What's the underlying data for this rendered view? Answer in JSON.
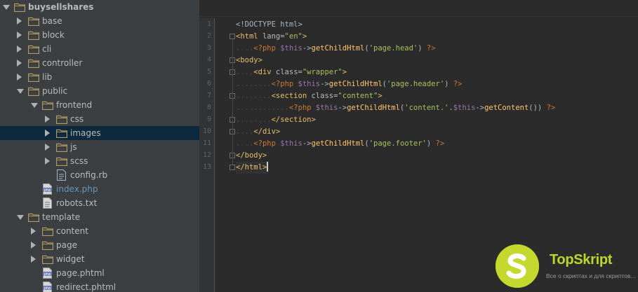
{
  "tree": [
    {
      "label": "buysellshares",
      "type": "folder",
      "level": 0,
      "expanded": true,
      "bold": true
    },
    {
      "label": "base",
      "type": "folder",
      "level": 1,
      "expanded": false
    },
    {
      "label": "block",
      "type": "folder",
      "level": 1,
      "expanded": false
    },
    {
      "label": "cli",
      "type": "folder",
      "level": 1,
      "expanded": false
    },
    {
      "label": "controller",
      "type": "folder",
      "level": 1,
      "expanded": false
    },
    {
      "label": "lib",
      "type": "folder",
      "level": 1,
      "expanded": false
    },
    {
      "label": "public",
      "type": "folder",
      "level": 1,
      "expanded": true
    },
    {
      "label": "frontend",
      "type": "folder",
      "level": 2,
      "expanded": true
    },
    {
      "label": "css",
      "type": "folder",
      "level": 3,
      "expanded": false
    },
    {
      "label": "images",
      "type": "folder",
      "level": 3,
      "expanded": false,
      "selected": true
    },
    {
      "label": "js",
      "type": "folder",
      "level": 3,
      "expanded": false
    },
    {
      "label": "scss",
      "type": "folder",
      "level": 3,
      "expanded": false
    },
    {
      "label": "config.rb",
      "type": "file",
      "level": 3,
      "icon": "ruby-file-icon"
    },
    {
      "label": "index.php",
      "type": "file",
      "level": 2,
      "icon": "php-file-icon",
      "highlight": true
    },
    {
      "label": "robots.txt",
      "type": "file",
      "level": 2,
      "icon": "text-file-icon"
    },
    {
      "label": "template",
      "type": "folder",
      "level": 1,
      "expanded": true
    },
    {
      "label": "content",
      "type": "folder",
      "level": 2,
      "expanded": false
    },
    {
      "label": "page",
      "type": "folder",
      "level": 2,
      "expanded": false
    },
    {
      "label": "widget",
      "type": "folder",
      "level": 2,
      "expanded": false
    },
    {
      "label": "page.phtml",
      "type": "file",
      "level": 2,
      "icon": "php-file-icon"
    },
    {
      "label": "redirect.phtml",
      "type": "file",
      "level": 2,
      "icon": "php-file-icon"
    }
  ],
  "editor": {
    "line_numbers": [
      "1",
      "2",
      "3",
      "4",
      "5",
      "6",
      "7",
      "8",
      "9",
      "10",
      "11",
      "12",
      "13"
    ],
    "lines": [
      [
        {
          "t": "<!DOCTYPE html>",
          "c": "plain"
        }
      ],
      [
        {
          "t": "<html ",
          "c": "tag"
        },
        {
          "t": "lang=",
          "c": "attr"
        },
        {
          "t": "\"en\"",
          "c": "str"
        },
        {
          "t": ">",
          "c": "tag"
        }
      ],
      [
        {
          "t": "....",
          "c": "dots"
        },
        {
          "t": "<?php ",
          "c": "php"
        },
        {
          "t": "$this",
          "c": "var"
        },
        {
          "t": "->",
          "c": "plain"
        },
        {
          "t": "getChildHtml",
          "c": "func"
        },
        {
          "t": "(",
          "c": "plain"
        },
        {
          "t": "'page.head'",
          "c": "str"
        },
        {
          "t": ") ",
          "c": "plain"
        },
        {
          "t": "?>",
          "c": "php"
        }
      ],
      [
        {
          "t": "<body>",
          "c": "tag"
        }
      ],
      [
        {
          "t": "....",
          "c": "dots"
        },
        {
          "t": "<div ",
          "c": "tag"
        },
        {
          "t": "class=",
          "c": "attr"
        },
        {
          "t": "\"wrapper\"",
          "c": "str"
        },
        {
          "t": ">",
          "c": "tag"
        }
      ],
      [
        {
          "t": "........",
          "c": "dots"
        },
        {
          "t": "<?php ",
          "c": "php"
        },
        {
          "t": "$this",
          "c": "var"
        },
        {
          "t": "->",
          "c": "plain"
        },
        {
          "t": "getChildHtml",
          "c": "func"
        },
        {
          "t": "(",
          "c": "plain"
        },
        {
          "t": "'page.header'",
          "c": "str"
        },
        {
          "t": ") ",
          "c": "plain"
        },
        {
          "t": "?>",
          "c": "php"
        }
      ],
      [
        {
          "t": "........",
          "c": "dots"
        },
        {
          "t": "<section ",
          "c": "tag"
        },
        {
          "t": "class=",
          "c": "attr"
        },
        {
          "t": "\"content\"",
          "c": "str"
        },
        {
          "t": ">",
          "c": "tag"
        }
      ],
      [
        {
          "t": "............",
          "c": "dots"
        },
        {
          "t": "<?php ",
          "c": "php"
        },
        {
          "t": "$this",
          "c": "var"
        },
        {
          "t": "->",
          "c": "plain"
        },
        {
          "t": "getChildHtml",
          "c": "func"
        },
        {
          "t": "(",
          "c": "plain"
        },
        {
          "t": "'content.'",
          "c": "str"
        },
        {
          "t": ".",
          "c": "plain"
        },
        {
          "t": "$this",
          "c": "var"
        },
        {
          "t": "->",
          "c": "plain"
        },
        {
          "t": "getContent",
          "c": "func"
        },
        {
          "t": "()) ",
          "c": "plain"
        },
        {
          "t": "?>",
          "c": "php"
        }
      ],
      [
        {
          "t": "........",
          "c": "dots"
        },
        {
          "t": "</section>",
          "c": "tag"
        }
      ],
      [
        {
          "t": "....",
          "c": "dots"
        },
        {
          "t": "</div>",
          "c": "tag"
        }
      ],
      [
        {
          "t": "....",
          "c": "dots"
        },
        {
          "t": "<?php ",
          "c": "php"
        },
        {
          "t": "$this",
          "c": "var"
        },
        {
          "t": "->",
          "c": "plain"
        },
        {
          "t": "getChildHtml",
          "c": "func"
        },
        {
          "t": "(",
          "c": "plain"
        },
        {
          "t": "'page.footer'",
          "c": "str"
        },
        {
          "t": ") ",
          "c": "plain"
        },
        {
          "t": "?>",
          "c": "php"
        }
      ],
      [
        {
          "t": "</body>",
          "c": "tag"
        }
      ],
      [
        {
          "t": "</html>",
          "c": "tag"
        }
      ]
    ],
    "caret_line": 13
  },
  "watermark": {
    "brand": "TopSkript",
    "subtitle": "Все о скриптах и для скриптов...",
    "logo_letter": "S"
  },
  "colors": {
    "tree_bg": "#3c3f41",
    "editor_bg": "#2b2b2b",
    "selection": "#0d293e",
    "folder": "#b29a64",
    "brand": "#c4d82e"
  }
}
